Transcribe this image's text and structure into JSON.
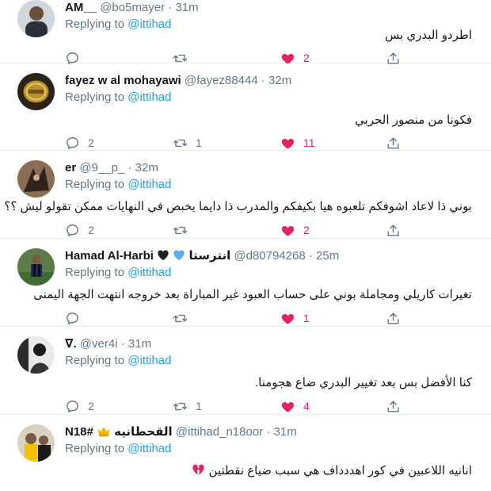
{
  "colors": {
    "accent": "#1da1f2",
    "like": "#e0245e",
    "muted": "#657786",
    "border": "#e6ecf0"
  },
  "replying_prefix": "Replying to",
  "replying_handle": "@ittihad",
  "tweets": [
    {
      "name": "AM__",
      "handle": "@bo5mayer",
      "time": "31m",
      "text": "اطردو البدري بس",
      "replies": "",
      "retweets": "",
      "likes": "2"
    },
    {
      "name": "fayez w al mohayawi",
      "handle": "@fayez88444",
      "time": "32m",
      "text": "فكونا من منصور الحربي",
      "replies": "2",
      "retweets": "1",
      "likes": "11"
    },
    {
      "name": "er",
      "handle": "@9__p_",
      "time": "32m",
      "text": "بوني ذا لاعاد اشوفكم تلعبوه هيا بكيفكم والمدرب ذا دايما يخبص في النهايات ممكن تقولو ليش ؟؟",
      "replies": "2",
      "retweets": "",
      "likes": "2"
    },
    {
      "name": "Hamad Al-Harbi",
      "name_suffix": "انترستا",
      "handle": "@d80794268",
      "time": "25m",
      "text": "تغيرات كاريلي ومجاملة بوني على حساب العبود غير المباراة بعد خروجه انتهت الجهة اليمنى",
      "replies": "",
      "retweets": "",
      "likes": "1"
    },
    {
      "name": "∇.",
      "handle": "@ver4i",
      "time": "31m",
      "text": "كنا الأفضل بس بعد تغيير البدري ضاع هجومنا.",
      "replies": "2",
      "retweets": "1",
      "likes": "4"
    },
    {
      "name": "N18#",
      "name_suffix": "القحطانيه",
      "handle": "@ittihad_n18oor",
      "time": "31m",
      "text": "انانيه اللاعبين في كور اهددداف هي سبب ضياع نقطتين",
      "replies": "",
      "retweets": "",
      "likes": ""
    }
  ]
}
